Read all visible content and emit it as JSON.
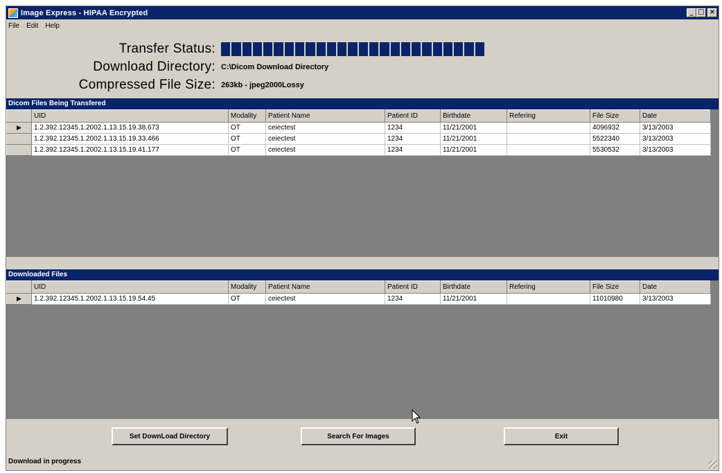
{
  "window": {
    "title": "Image Express - HIPAA Encrypted"
  },
  "menu": [
    "File",
    "Edit",
    "Help"
  ],
  "transfer": {
    "status_label": "Transfer Status:",
    "progress_fraction": 0.95,
    "dir_label": "Download Directory:",
    "dir_value": "C:\\Dicom Download Directory",
    "size_label": "Compressed File Size:",
    "size_value": "263kb - jpeg2000Lossy"
  },
  "transferring": {
    "header": "Dicom Files Being Transfered",
    "columns": [
      "UID",
      "Modality",
      "Patient Name",
      "Patient ID",
      "Birthdate",
      "Refering",
      "File Size",
      "Date"
    ],
    "rows": [
      [
        "1.2.392.12345.1.2002.1.13.15.19.38.673",
        "OT",
        "ceiectest",
        "1234",
        "11/21/2001",
        "",
        "4096932",
        "3/13/2003"
      ],
      [
        "1.2.392.12345.1.2002.1.13.15.19.33.466",
        "OT",
        "ceiectest",
        "1234",
        "11/21/2001",
        "",
        "5522340",
        "3/13/2003"
      ],
      [
        "1.2.392.12345.1.2002.1.13.15.19.41.177",
        "OT",
        "ceiectest",
        "1234",
        "11/21/2001",
        "",
        "5530532",
        "3/13/2003"
      ]
    ]
  },
  "downloaded": {
    "header": "Downloaded Files",
    "columns": [
      "UID",
      "Modality",
      "Patient Name",
      "Patient ID",
      "Birthdate",
      "Refering",
      "File Size",
      "Date"
    ],
    "rows": [
      [
        "1.2.392.12345.1.2002.1.13.15.19.54.45",
        "OT",
        "ceiectest",
        "1234",
        "11/21/2001",
        "",
        "11010980",
        "3/13/2003"
      ]
    ]
  },
  "buttons": {
    "set_dir": "Set DownLoad Directory",
    "search": "Search For Images",
    "exit": "Exit"
  },
  "status_bar": "Download in progress",
  "colors": {
    "title_bar": "#0a246a",
    "face": "#d4d0c8",
    "grid_bg": "#808080"
  }
}
